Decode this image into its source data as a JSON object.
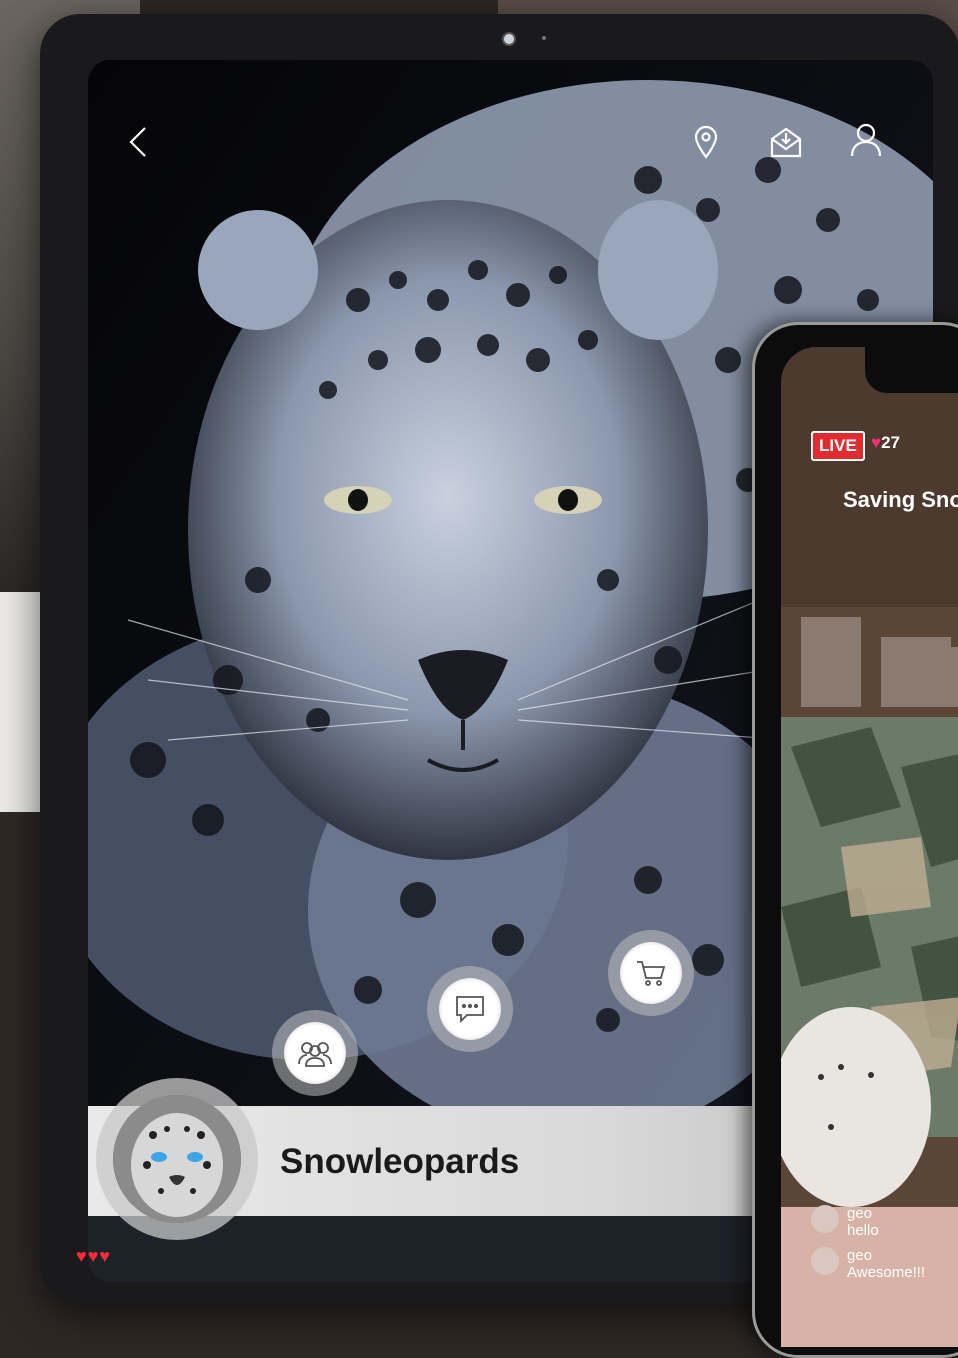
{
  "tablet": {
    "nav": {
      "back_icon": "chevron-left-icon",
      "location_icon": "map-pin-icon",
      "mail_icon": "mail-open-icon",
      "profile_icon": "user-icon"
    },
    "actions": [
      {
        "name": "group-button",
        "icon": "group-icon"
      },
      {
        "name": "chat-button",
        "icon": "chat-icon"
      },
      {
        "name": "cart-button",
        "icon": "cart-icon"
      }
    ],
    "profile": {
      "name": "Snowleopards"
    }
  },
  "phone": {
    "live_label": "LIVE",
    "heart_count": "27",
    "stream_title": "Saving Sno",
    "comments": [
      {
        "user": "geo",
        "text": "hello"
      },
      {
        "user": "geo",
        "text": "Awesome!!!"
      }
    ],
    "reaction_hearts": "♥♥♥"
  },
  "colors": {
    "live_red": "#e32a2f",
    "heart_pink": "#ff2d6d"
  }
}
